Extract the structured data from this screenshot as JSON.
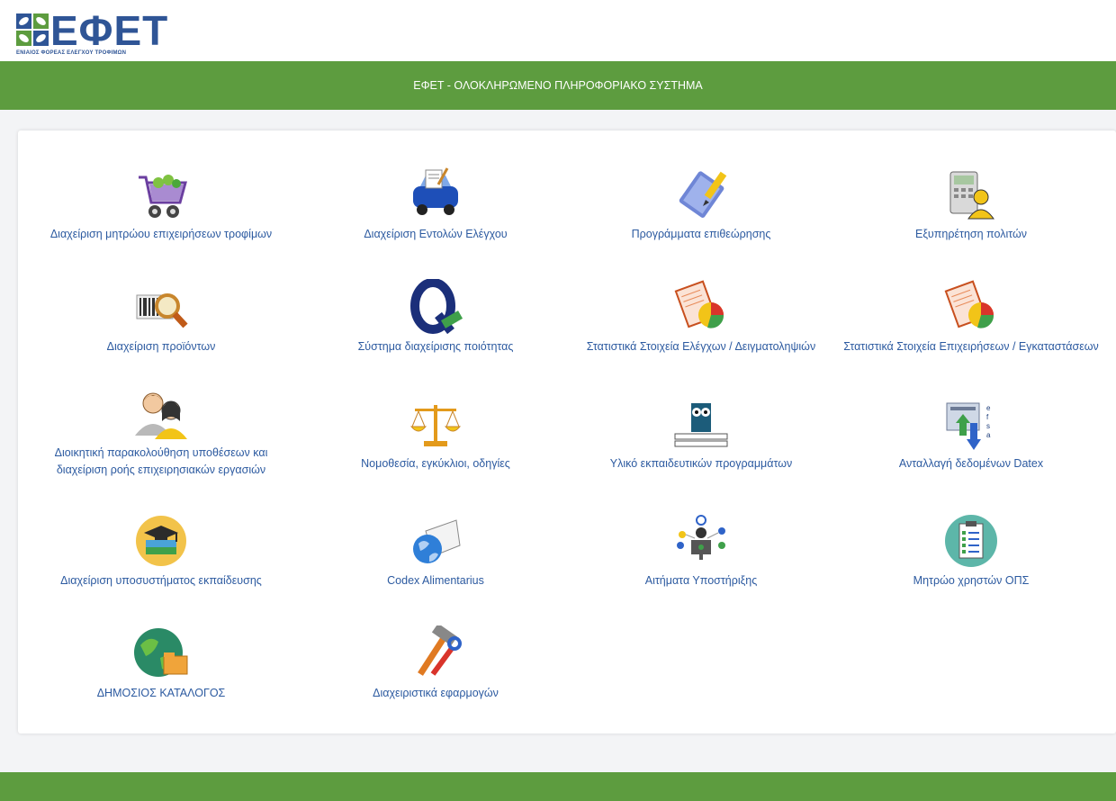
{
  "logo": {
    "word": "ΕΦΕΤ",
    "subtitle": "ΕΝΙΑΙΟΣ ΦΟΡΕΑΣ ΕΛΕΓΧΟΥ ΤΡΟΦΙΜΩΝ"
  },
  "header": {
    "title": "ΕΦΕΤ - ΟΛΟΚΛΗΡΩΜΕΝΟ ΠΛΗΡΟΦΟΡΙΑΚΟ ΣΥΣΤΗΜΑ"
  },
  "colors": {
    "brand_green": "#5d9c3f",
    "link_blue": "#2c5aa0",
    "logo_blue": "#2f5596"
  },
  "tiles": [
    {
      "label": "Διαχείριση μητρώου επιχειρήσεων τροφίμων",
      "icon": "shopping-cart-icon"
    },
    {
      "label": "Διαχείριση Εντολών Ελέγχου",
      "icon": "inspection-car-icon"
    },
    {
      "label": "Προγράμματα επιθεώρησης",
      "icon": "notepad-pencil-icon"
    },
    {
      "label": "Εξυπηρέτηση πολιτών",
      "icon": "phone-user-icon"
    },
    {
      "label": "Διαχείριση προϊόντων",
      "icon": "barcode-magnifier-icon"
    },
    {
      "label": "Σύστημα διαχείρισης ποιότητας",
      "icon": "quality-q-icon"
    },
    {
      "label": "Στατιστικά Στοιχεία Ελέγχων / Δειγματοληψιών",
      "icon": "report-pie-chart-icon"
    },
    {
      "label": "Στατιστικά Στοιχεία Επιχειρήσεων / Εγκαταστάσεων",
      "icon": "report-pie-chart-icon"
    },
    {
      "label": "Διοικητική παρακολούθηση υποθέσεων και",
      "label2": "διαχείριση ροής επιχειρησιακών εργασιών",
      "icon": "users-workflow-icon"
    },
    {
      "label": "Νομοθεσία, εγκύκλιοι, οδηγίες",
      "icon": "scales-icon"
    },
    {
      "label": "Υλικό εκπαιδευτικών προγραμμάτων",
      "icon": "owl-books-icon"
    },
    {
      "label": "Ανταλλαγή δεδομένων Datex",
      "icon": "data-exchange-efsa-icon"
    },
    {
      "label": "Διαχείριση υποσυστήματος εκπαίδευσης",
      "icon": "graduation-books-icon"
    },
    {
      "label": "Codex Alimentarius",
      "icon": "globe-envelope-icon"
    },
    {
      "label": "Αιτήματα Υποστήριξης",
      "icon": "support-network-icon"
    },
    {
      "label": "Μητρώο χρηστών ΟΠΣ",
      "icon": "clipboard-checklist-icon"
    },
    {
      "label": "ΔΗΜΟΣΙΟΣ ΚΑΤΑΛΟΓΟΣ",
      "icon": "globe-folder-icon"
    },
    {
      "label": "Διαχειριστικά εφαρμογών",
      "icon": "hammer-wrench-icon"
    }
  ],
  "footer": {
    "text": ""
  }
}
